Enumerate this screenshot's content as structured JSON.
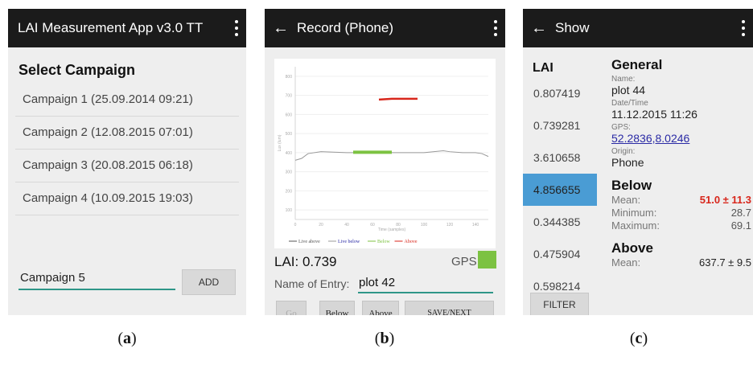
{
  "panel_a": {
    "title": "LAI Measurement App v3.0 TT",
    "section_title": "Select Campaign",
    "campaigns": [
      "Campaign 1 (25.09.2014 09:21)",
      "Campaign 2 (12.08.2015 07:01)",
      "Campaign 3 (20.08.2015 06:18)",
      "Campaign 4 (10.09.2015 19:03)"
    ],
    "new_campaign_value": "Campaign 5",
    "add_label": "ADD",
    "caption": "(a)",
    "caption_letter": "a"
  },
  "panel_b": {
    "back_icon": "arrow-left-icon",
    "title": "Record (Phone)",
    "lai_readout": "LAI: 0.739",
    "gps_label": "GPS:",
    "gps_status_color": "#7cc242",
    "entry_label": "Name of Entry:",
    "entry_value": "plot 42",
    "buttons": {
      "go": "Go",
      "below": "Below",
      "above": "Above",
      "save": "SAVE/NEXT"
    },
    "caption": "(b)",
    "caption_letter": "b"
  },
  "chart_data": {
    "type": "line",
    "xlabel": "Time (samples)",
    "ylabel": "Lux (lum)",
    "x_ticks": [
      0,
      20,
      40,
      60,
      80,
      100,
      120,
      140
    ],
    "y_ticks": [
      100,
      200,
      300,
      400,
      500,
      600,
      700,
      800
    ],
    "xlim": [
      0,
      150
    ],
    "ylim": [
      50,
      850
    ],
    "series": [
      {
        "name": "Live above",
        "color": "#555555",
        "x": [],
        "y": []
      },
      {
        "name": "Live below",
        "color": "#999999",
        "x": [
          0,
          5,
          10,
          20,
          40,
          60,
          80,
          100,
          115,
          120,
          130,
          140,
          145,
          150
        ],
        "y": [
          360,
          370,
          395,
          405,
          400,
          400,
          400,
          400,
          410,
          405,
          400,
          400,
          395,
          380
        ]
      },
      {
        "name": "Below",
        "color": "#7cc242",
        "x": [
          45,
          55,
          65,
          75
        ],
        "y": [
          402,
          402,
          402,
          402
        ]
      },
      {
        "name": "Above",
        "color": "#d8261b",
        "x": [
          65,
          75,
          85,
          95
        ],
        "y": [
          678,
          682,
          682,
          682
        ]
      }
    ]
  },
  "panel_c": {
    "back_icon": "arrow-left-icon",
    "title": "Show",
    "lai_header": "LAI",
    "lai_values": [
      "0.807419",
      "0.739281",
      "3.610658",
      "4.856655",
      "0.344385",
      "0.475904",
      "0.598214"
    ],
    "selected_index": 3,
    "selected_color": "#4a9cd4",
    "filter_label": "FILTER",
    "general": {
      "heading": "General",
      "name_label": "Name:",
      "name_value": "plot 44",
      "datetime_label": "Date/Time",
      "datetime_value": "11.12.2015 11:26",
      "gps_label": "GPS:",
      "gps_value": "52.2836,8.0246",
      "origin_label": "Origin:",
      "origin_value": "Phone"
    },
    "below": {
      "heading": "Below",
      "mean_label": "Mean:",
      "mean_value": "51.0 ± 11.3",
      "min_label": "Minimum:",
      "min_value": "28.7",
      "max_label": "Maximum:",
      "max_value": "69.1"
    },
    "above": {
      "heading": "Above",
      "mean_label": "Mean:",
      "mean_value": "637.7 ± 9.5"
    },
    "caption": "(c)",
    "caption_letter": "c"
  }
}
